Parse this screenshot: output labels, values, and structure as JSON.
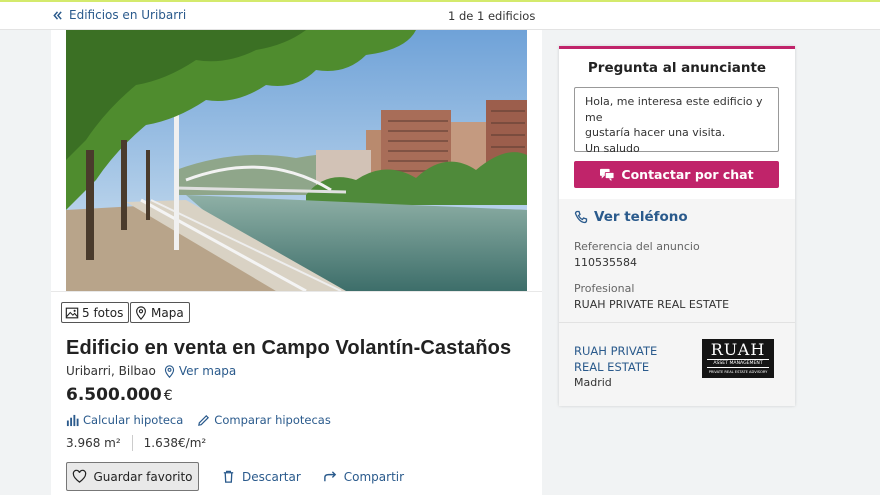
{
  "topbar": {
    "back_label": "Edificios en Uribarri",
    "counter": "1 de 1 edificios"
  },
  "listing": {
    "photos_chip": "5 fotos",
    "map_chip": "Mapa",
    "title": "Edificio en venta en Campo Volantín-Castaños",
    "location": "Uribarri, Bilbao",
    "see_map": "Ver mapa",
    "price": "6.500.000",
    "currency": "€",
    "calc_mortgage": "Calcular hipoteca",
    "compare_mortgages": "Comparar hipotecas",
    "area": "3.968 m²",
    "price_per_m2": "1.638€/m²",
    "save_favorite": "Guardar favorito",
    "discard": "Descartar",
    "share": "Compartir"
  },
  "contact": {
    "title": "Pregunta al anunciante",
    "message_line1": "Hola, me interesa este edificio y me",
    "message_line2": "gustaría hacer una visita.",
    "message_line3": "Un saludo",
    "chat_button": "Contactar por chat",
    "phone_link": "Ver teléfono",
    "ref_label": "Referencia del anuncio",
    "ref_value": "110535584",
    "professional_label": "Profesional",
    "professional_value": "RUAH PRIVATE REAL ESTATE",
    "agency_name": "RUAH PRIVATE REAL ESTATE",
    "agency_city": "Madrid",
    "logo_main": "RUAH",
    "logo_sub": "ASSET MANAGEMENT",
    "logo_tag": "PRIVATE REAL ESTATE ADVISORY"
  },
  "colors": {
    "accent": "#c0246a",
    "link": "#2a5a8c",
    "top_line": "#d4ea6c"
  },
  "icons": [
    "double-chevron-left-icon",
    "image-icon",
    "map-pin-icon",
    "chart-bars-icon",
    "pencil-icon",
    "heart-icon",
    "trash-icon",
    "share-arrow-icon",
    "chat-icon",
    "phone-icon"
  ]
}
